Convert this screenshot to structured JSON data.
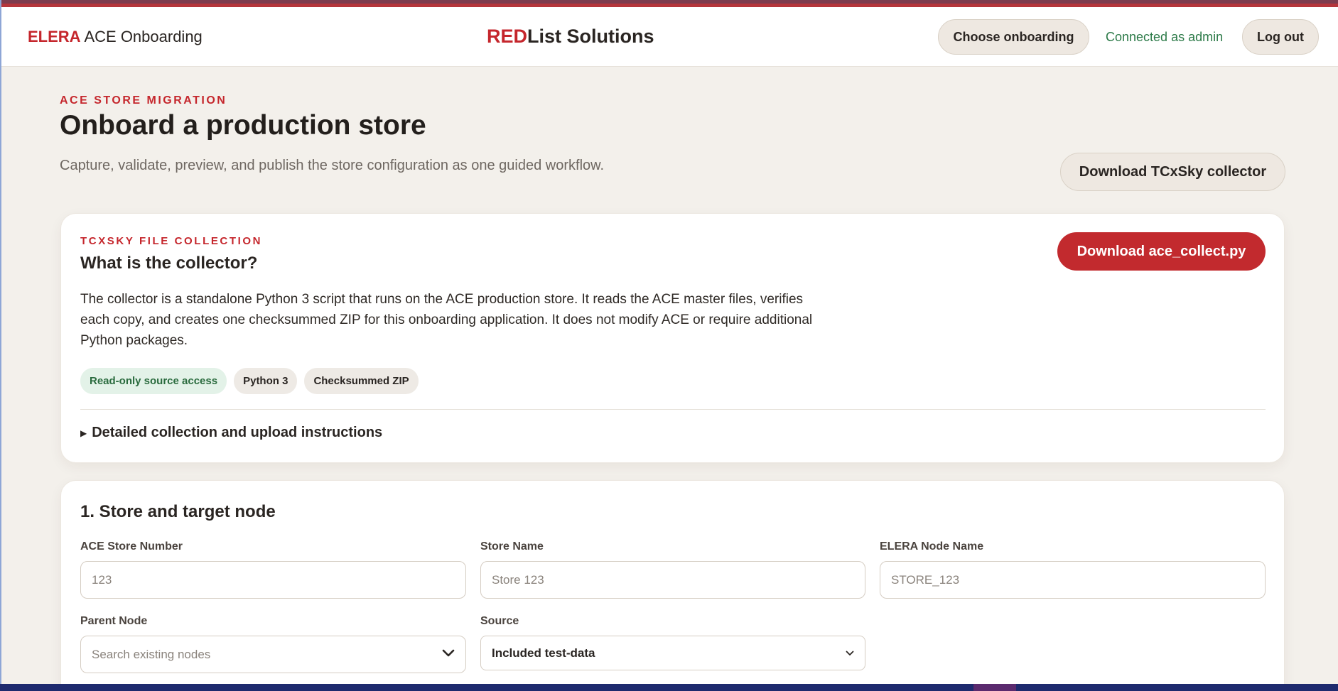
{
  "header": {
    "brand_accent": "ELERA",
    "brand_rest": "ACE Onboarding",
    "logo_red": "RED",
    "logo_rest": "List Solutions",
    "choose_label": "Choose onboarding",
    "connected_text": "Connected as admin",
    "logout_label": "Log out"
  },
  "page": {
    "eyebrow": "ACE STORE MIGRATION",
    "title": "Onboard a production store",
    "subtitle": "Capture, validate, preview, and publish the store configuration as one guided workflow.",
    "download_collector_label": "Download TCxSky collector"
  },
  "collector_card": {
    "eyebrow": "TCXSKY FILE COLLECTION",
    "title": "What is the collector?",
    "description": "The collector is a standalone Python 3 script that runs on the ACE production store. It reads the ACE master files, verifies each copy, and creates one checksummed ZIP for this onboarding application. It does not modify ACE or require additional Python packages.",
    "download_label": "Download ace_collect.py",
    "tags": [
      "Read-only source access",
      "Python 3",
      "Checksummed ZIP"
    ],
    "details_label": "Detailed collection and upload instructions"
  },
  "store_card": {
    "title": "1. Store and target node",
    "fields": {
      "store_number": {
        "label": "ACE Store Number",
        "placeholder": "123"
      },
      "store_name": {
        "label": "Store Name",
        "placeholder": "Store 123"
      },
      "node_name": {
        "label": "ELERA Node Name",
        "placeholder": "STORE_123"
      },
      "parent_node": {
        "label": "Parent Node",
        "placeholder": "Search existing nodes"
      },
      "source": {
        "label": "Source",
        "value": "Included test-data"
      }
    }
  },
  "colors": {
    "accent_red": "#c5262c",
    "button_red": "#c22a2e",
    "connected_green": "#2c7a48",
    "background": "#f3f0eb"
  },
  "icons": {
    "details_toggle": "triangle-right-icon",
    "parent_node_dropdown": "chevron-down-icon",
    "source_dropdown": "chevron-down-icon"
  }
}
